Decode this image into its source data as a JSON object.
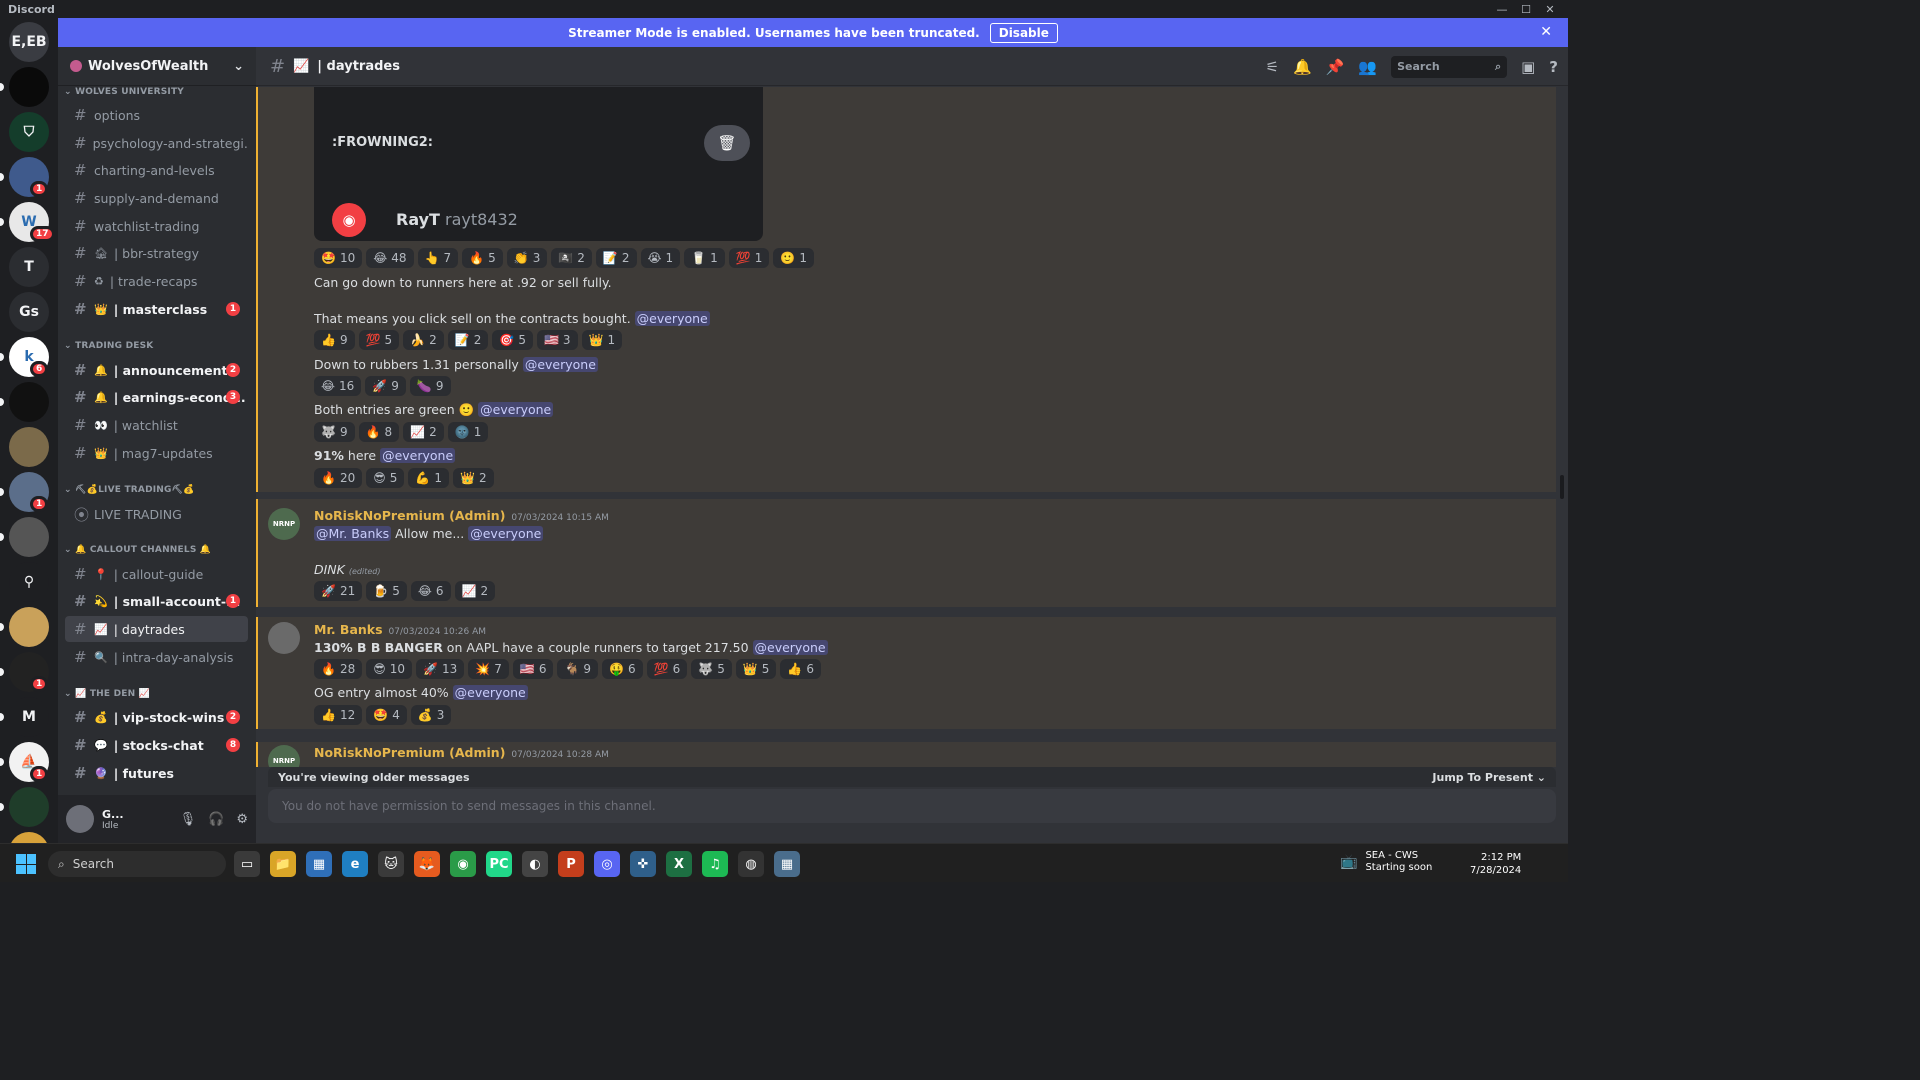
{
  "window": {
    "title": "Discord",
    "min": "—",
    "max": "☐",
    "close": "✕"
  },
  "banner": {
    "text": "Streamer Mode is enabled. Usernames have been truncated.",
    "button": "Disable",
    "close": "✕"
  },
  "guilds": [
    {
      "label": "E,EB",
      "color": "#3a3c42",
      "badge": ""
    },
    {
      "label": "",
      "color": "#0a0a0a",
      "badge": ""
    },
    {
      "label": "⛉",
      "color": "#143d2b",
      "badge": ""
    },
    {
      "label": "",
      "color": "#3f5a8c",
      "badge": "1"
    },
    {
      "label": "W",
      "color": "#e8e8e8",
      "badge": "17"
    },
    {
      "label": "T",
      "color": "#2b2d31",
      "badge": ""
    },
    {
      "label": "Gs",
      "color": "#2b2d31",
      "badge": ""
    },
    {
      "label": "k",
      "color": "#ffffff",
      "badge": "6"
    },
    {
      "label": "",
      "color": "#111111",
      "badge": ""
    },
    {
      "label": "",
      "color": "#7b6a4a",
      "badge": ""
    },
    {
      "label": "",
      "color": "#5b6e8a",
      "badge": "1"
    },
    {
      "label": "",
      "color": "#555555",
      "badge": ""
    },
    {
      "label": "⚲",
      "color": "#1e1f22",
      "badge": ""
    },
    {
      "label": "",
      "color": "#c9a15a",
      "badge": ""
    },
    {
      "label": "",
      "color": "#222222",
      "badge": "1"
    },
    {
      "label": "M",
      "color": "#1e1f22",
      "badge": ""
    },
    {
      "label": "⛵",
      "color": "#f2f2f2",
      "badge": "1"
    },
    {
      "label": "",
      "color": "#1f3d2a",
      "badge": ""
    },
    {
      "label": "",
      "color": "#d8a23a",
      "badge": ""
    }
  ],
  "server": {
    "name": "WolvesOfWealth",
    "chevron": "⌄"
  },
  "categories": [
    {
      "label": "WOLVES UNIVERSITY"
    },
    {
      "label": "TRADING DESK"
    },
    {
      "label": "⛏💰LIVE TRADING⛏💰"
    },
    {
      "label": "🔔 CALLOUT CHANNELS 🔔"
    },
    {
      "label": "📈 THE DEN 📈"
    }
  ],
  "channels": [
    {
      "name": "options",
      "emoji": "",
      "unread": false,
      "badge": "",
      "active": false
    },
    {
      "name": "psychology-and-strategi...",
      "emoji": "",
      "unread": false,
      "badge": "",
      "active": false
    },
    {
      "name": "charting-and-levels",
      "emoji": "",
      "unread": false,
      "badge": "",
      "active": false
    },
    {
      "name": "supply-and-demand",
      "emoji": "",
      "unread": false,
      "badge": "",
      "active": false
    },
    {
      "name": "watchlist-trading",
      "emoji": "",
      "unread": false,
      "badge": "",
      "active": false
    },
    {
      "name": "| bbr-strategy",
      "emoji": "🏚",
      "unread": false,
      "badge": "",
      "active": false
    },
    {
      "name": "| trade-recaps",
      "emoji": "♻",
      "unread": false,
      "badge": "",
      "active": false
    },
    {
      "name": "| masterclass",
      "emoji": "👑",
      "unread": true,
      "badge": "1",
      "active": false
    },
    {
      "name": "| announcements",
      "emoji": "🔔",
      "unread": true,
      "badge": "2",
      "active": false
    },
    {
      "name": "| earnings-econo...",
      "emoji": "🔔",
      "unread": true,
      "badge": "3",
      "active": false
    },
    {
      "name": "| watchlist",
      "emoji": "👀",
      "unread": false,
      "badge": "",
      "active": false
    },
    {
      "name": "| mag7-updates",
      "emoji": "👑",
      "unread": false,
      "badge": "",
      "active": false
    },
    {
      "name": "LIVE TRADING",
      "emoji": "",
      "unread": false,
      "badge": "",
      "active": false
    },
    {
      "name": "| callout-guide",
      "emoji": "📍",
      "unread": false,
      "badge": "",
      "active": false
    },
    {
      "name": "| small-account-...",
      "emoji": "💫",
      "unread": true,
      "badge": "1",
      "active": false
    },
    {
      "name": "| daytrades",
      "emoji": "📈",
      "unread": false,
      "badge": "",
      "active": true
    },
    {
      "name": "| intra-day-analysis",
      "emoji": "🔍",
      "unread": false,
      "badge": "",
      "active": false
    },
    {
      "name": "| vip-stock-wins",
      "emoji": "💰",
      "unread": true,
      "badge": "2",
      "active": false
    },
    {
      "name": "| stocks-chat",
      "emoji": "💬",
      "unread": true,
      "badge": "8",
      "active": false
    },
    {
      "name": "| futures",
      "emoji": "🔮",
      "unread": true,
      "badge": "",
      "active": false
    }
  ],
  "user": {
    "name": "G...",
    "status": "Idle",
    "mic": "🎙",
    "headset": "🎧",
    "settings": "⚙"
  },
  "header": {
    "channel": "| daytrades",
    "emoji": "📈",
    "search_placeholder": "Search"
  },
  "embed": {
    "text": ":FROWNING2:",
    "trash": "🗑",
    "user": "RayT",
    "handle": "rayt8432"
  },
  "reaction_rows": [
    [
      {
        "e": "🤩",
        "n": "10"
      },
      {
        "e": "😂",
        "n": "48"
      },
      {
        "e": "👆",
        "n": "7"
      },
      {
        "e": "🔥",
        "n": "5"
      },
      {
        "e": "👏",
        "n": "3"
      },
      {
        "e": "🏴‍☠️",
        "n": "2"
      },
      {
        "e": "📝",
        "n": "2"
      },
      {
        "e": "😭",
        "n": "1"
      },
      {
        "e": "🥛",
        "n": "1"
      },
      {
        "e": "💯",
        "n": "1"
      },
      {
        "e": "🙂",
        "n": "1"
      }
    ],
    [
      {
        "e": "👍",
        "n": "9"
      },
      {
        "e": "💯",
        "n": "5"
      },
      {
        "e": "🍌",
        "n": "2"
      },
      {
        "e": "📝",
        "n": "2"
      },
      {
        "e": "🎯",
        "n": "5"
      },
      {
        "e": "🇺🇸",
        "n": "3"
      },
      {
        "e": "👑",
        "n": "1"
      }
    ],
    [
      {
        "e": "😂",
        "n": "16"
      },
      {
        "e": "🚀",
        "n": "9"
      },
      {
        "e": "🍆",
        "n": "9"
      }
    ],
    [
      {
        "e": "🐺",
        "n": "9"
      },
      {
        "e": "🔥",
        "n": "8"
      },
      {
        "e": "📈",
        "n": "2"
      },
      {
        "e": "🌚",
        "n": "1"
      }
    ],
    [
      {
        "e": "🔥",
        "n": "20"
      },
      {
        "e": "😎",
        "n": "5"
      },
      {
        "e": "💪",
        "n": "1"
      },
      {
        "e": "👑",
        "n": "2"
      }
    ],
    [
      {
        "e": "🚀",
        "n": "21"
      },
      {
        "e": "🍺",
        "n": "5"
      },
      {
        "e": "😂",
        "n": "6"
      },
      {
        "e": "📈",
        "n": "2"
      }
    ],
    [
      {
        "e": "🔥",
        "n": "28"
      },
      {
        "e": "😎",
        "n": "10"
      },
      {
        "e": "🚀",
        "n": "13"
      },
      {
        "e": "💥",
        "n": "7"
      },
      {
        "e": "🇺🇸",
        "n": "6"
      },
      {
        "e": "🐐",
        "n": "9"
      },
      {
        "e": "🤑",
        "n": "6"
      },
      {
        "e": "💯",
        "n": "6"
      },
      {
        "e": "🐺",
        "n": "5"
      },
      {
        "e": "👑",
        "n": "5"
      },
      {
        "e": "👍",
        "n": "6"
      }
    ],
    [
      {
        "e": "👍",
        "n": "12"
      },
      {
        "e": "🤩",
        "n": "4"
      },
      {
        "e": "💰",
        "n": "3"
      }
    ]
  ],
  "messages": {
    "m1": "Can go down to runners here at .92 or sell fully.",
    "m2": "That means you click sell on the contracts bought.",
    "m3": "Down to rubbers 1.31 personally",
    "m4": "Both entries are green",
    "m4_emoji": "🙂",
    "m5_bold": "91%",
    "m5": " here",
    "everyone": "@everyone",
    "author1": "NoRiskNoPremium (Admin)",
    "ts1": "07/03/2024 10:15 AM",
    "mention_banks": "@Mr. Banks",
    "m6": " Allow me...",
    "m7": "DINK",
    "edited": "(edited)",
    "author2": "Mr. Banks",
    "ts2": "07/03/2024 10:26 AM",
    "m8_bold": "130% B B BANGER",
    "m8": " on AAPL have a couple runners to target 217.50",
    "m9": "OG entry almost 40%",
    "author3": "NoRiskNoPremium (Admin)",
    "ts3": "07/03/2024 10:28 AM",
    "avatar1": "NRNP"
  },
  "older": {
    "text": "You're viewing older messages",
    "jump": "Jump To Present ⌄"
  },
  "composer": {
    "placeholder": "You do not have permission to send messages in this channel."
  },
  "taskbar": {
    "search": "Search",
    "weather_title": "SEA - CWS",
    "weather_sub": "Starting soon",
    "time": "2:12 PM",
    "date": "7/28/2024",
    "apps": [
      {
        "icon": "▭",
        "color": "#3a3a3a"
      },
      {
        "icon": "📁",
        "color": "#d9a527"
      },
      {
        "icon": "▦",
        "color": "#2f6fb8"
      },
      {
        "icon": "e",
        "color": "#1f7fc2"
      },
      {
        "icon": "🐱",
        "color": "#3a3a3a"
      },
      {
        "icon": "🦊",
        "color": "#e55b1f"
      },
      {
        "icon": "◉",
        "color": "#2a9b48"
      },
      {
        "icon": "PC",
        "color": "#21d789"
      },
      {
        "icon": "◐",
        "color": "#444444"
      },
      {
        "icon": "P",
        "color": "#c43e1c"
      },
      {
        "icon": "◎",
        "color": "#5865f2"
      },
      {
        "icon": "✜",
        "color": "#2f5f8a"
      },
      {
        "icon": "X",
        "color": "#1d6f42"
      },
      {
        "icon": "♫",
        "color": "#1db954"
      },
      {
        "icon": "◍",
        "color": "#333333"
      },
      {
        "icon": "▦",
        "color": "#4a6d8c"
      }
    ]
  }
}
